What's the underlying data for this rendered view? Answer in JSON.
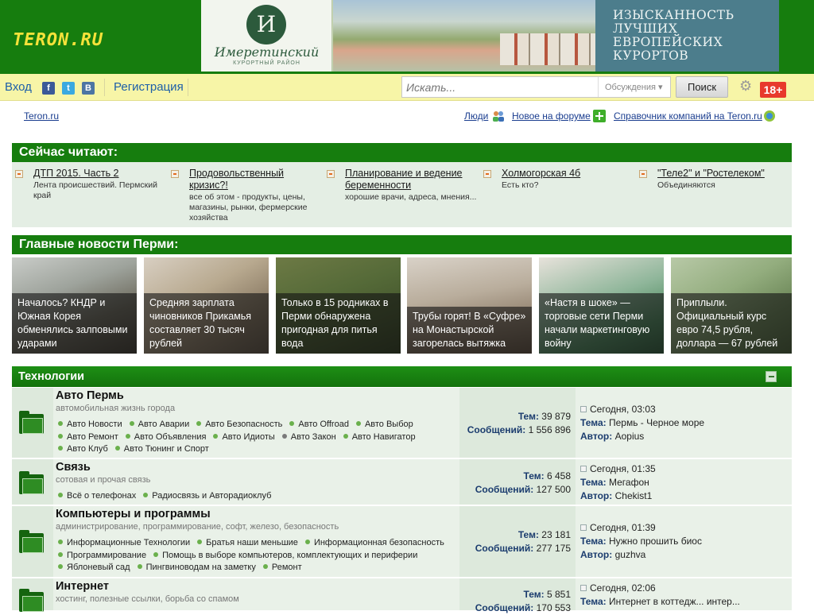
{
  "header": {
    "logo": "TERON.RU",
    "banner": {
      "monogram": "И",
      "name": "Имеретинский",
      "subtitle": "КУРОРТНЫЙ РАЙОН",
      "slogan": "ИЗЫСКАННОСТЬ ЛУЧШИХ ЕВРОПЕЙСКИХ КУРОРТОВ"
    }
  },
  "toolbar": {
    "login": "Вход",
    "facebook": "f",
    "twitter": "t",
    "vk": "B",
    "register": "Регистрация",
    "search_placeholder": "Искать...",
    "search_scope": "Обсуждения",
    "search_button": "Поиск",
    "age_badge": "18+"
  },
  "subnav": {
    "home": "Teron.ru",
    "people": "Люди",
    "forum_new": "Новое на форуме",
    "directory": "Справочник компаний на Teron.ru"
  },
  "reading": {
    "title": "Сейчас читают:",
    "items": [
      {
        "title": "ДТП 2015. Часть 2",
        "desc": "Лента происшествий. Пермский край"
      },
      {
        "title": "Продовольственный кризис?!",
        "desc": "все об этом - продукты, цены, магазины, рынки, фермерские хозяйства"
      },
      {
        "title": "Планирование и ведение беременности",
        "desc": "хорошие врачи, адреса, мнения..."
      },
      {
        "title": "Холмогорская 4б",
        "desc": "Есть кто?"
      },
      {
        "title": "\"Теле2\" и \"Ростелеком\"",
        "desc": "Объединяются"
      }
    ]
  },
  "news": {
    "title": "Главные новости Перми:",
    "items": [
      {
        "caption": "Началось? КНДР и Южная Корея обменялись залповыми ударами"
      },
      {
        "caption": "Средняя зарплата чиновников Прикамья составляет 30 тысяч рублей"
      },
      {
        "caption": "Только в 15 родниках в Перми обнаружена пригодная для питья вода"
      },
      {
        "caption": "Трубы горят! В «Суфре» на Монастырской загорелась вытяжка"
      },
      {
        "caption": "«Настя в шоке» — торговые сети Перми начали маркетинговую войну"
      },
      {
        "caption": "Приплыли. Официальный курс евро 74,5 рубля, доллара — 67 рублей"
      }
    ]
  },
  "forum": {
    "section": "Технологии",
    "labels": {
      "topics": "Тем:",
      "posts": "Сообщений:",
      "topic": "Тема:",
      "author": "Автор:"
    },
    "rows": [
      {
        "title": "Авто Пермь",
        "desc": "автомобильная жизнь города",
        "subforums": [
          "Авто Новости",
          "Авто Аварии",
          "Авто Безопасность",
          "Авто Offroad",
          "Авто Выбор",
          "Авто Ремонт",
          "Авто Объявления",
          "Авто Идиоты",
          "Авто Закон",
          "Авто Навигатор",
          "Авто Клуб",
          "Авто Тюнинг и Спорт"
        ],
        "topics": "39 879",
        "posts": "1 556 896",
        "last_time": "Сегодня, 03:03",
        "last_topic": "Пермь - Черное море",
        "last_author": "Aopius"
      },
      {
        "title": "Связь",
        "desc": "сотовая и прочая связь",
        "subforums": [
          "Всё о телефонах",
          "Радиосвязь и Авторадиоклуб"
        ],
        "topics": "6 458",
        "posts": "127 500",
        "last_time": "Сегодня, 01:35",
        "last_topic": "Мегафон",
        "last_author": "Chekist1"
      },
      {
        "title": "Компьютеры и программы",
        "desc": "администрирование, программирование, софт, железо, безопасность",
        "subforums": [
          "Информационные Технологии",
          "Братья наши меньшие",
          "Информационная безопасность",
          "Программирование",
          "Помощь в выборе компьютеров, комплектующих и периферии",
          "Яблоневый сад",
          "Пингвиноводам на заметку",
          "Ремонт"
        ],
        "topics": "23 181",
        "posts": "277 175",
        "last_time": "Сегодня, 01:39",
        "last_topic": "Нужно прошить биос",
        "last_author": "guzhva"
      },
      {
        "title": "Интернет",
        "desc": "хостинг, полезные ссылки, борьба со спамом",
        "subforums": [],
        "topics": "5 851",
        "posts": "170 553",
        "last_time": "Сегодня, 02:06",
        "last_topic": "Интернет в коттедж... интер...",
        "last_author": ""
      }
    ]
  },
  "colors": {
    "brand_green": "#167d0e",
    "logo_yellow": "#f5e23a",
    "toolbar_yellow": "#f7f5a7",
    "age_red": "#e8392c",
    "link_blue": "#1d5fa8"
  }
}
